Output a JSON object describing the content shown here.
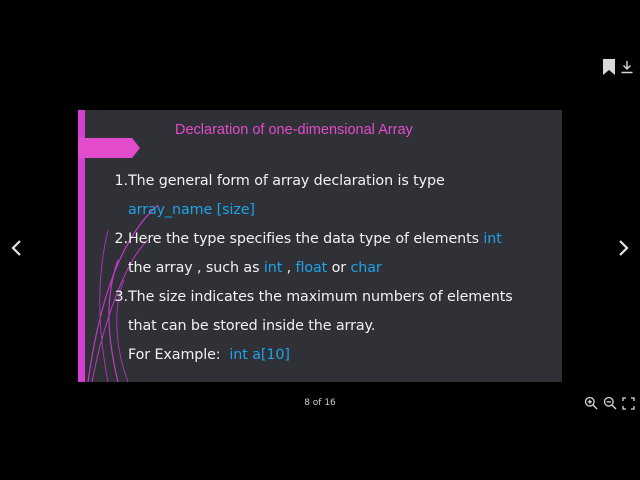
{
  "viewer": {
    "page_indicator": "8 of 16"
  },
  "slide": {
    "title": "Declaration of one-dimensional Array",
    "items": [
      {
        "number": "1.",
        "line1": "The general form of array declaration is type",
        "line2": "array_name [size]"
      },
      {
        "number": "2.",
        "line1_text": "Here the type specifies the data type of elements ",
        "line1_kw": "int",
        "line2_text1": "the array , such as ",
        "line2_kw1": "int",
        "line2_text2": " , ",
        "line2_kw2": "float",
        "line2_text3": " or ",
        "line2_kw3": "char"
      },
      {
        "number": "3.",
        "line1": "The size indicates the maximum numbers of elements",
        "line2": "that can be stored inside the array.",
        "example_label": "For Example:  ",
        "example_code": "int a[10]"
      }
    ]
  },
  "colors": {
    "accent": "#d63fd4",
    "title": "#e24bcc",
    "keyword": "#1fa3e8",
    "slide_bg": "#2f3136"
  },
  "icons": {
    "bookmark": "bookmark-icon",
    "download": "download-icon",
    "prev": "chevron-left-icon",
    "next": "chevron-right-icon",
    "zoom_in": "zoom-in-icon",
    "zoom_out": "zoom-out-icon",
    "fullscreen": "fullscreen-icon"
  }
}
